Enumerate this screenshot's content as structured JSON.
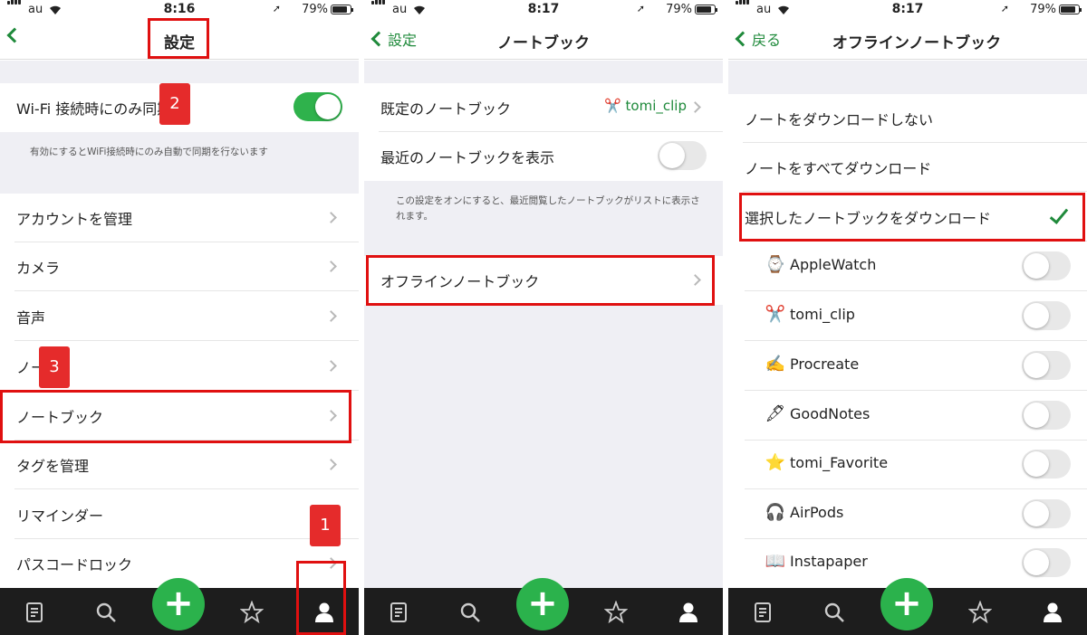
{
  "status": {
    "carrier": "au",
    "battery": "79%"
  },
  "panel1": {
    "time": "8:16",
    "title": "設定",
    "wifi_row": "Wi-Fi 接続時にのみ同期",
    "wifi_note": "有効にするとWiFi接続時にのみ自動で同期を行ないます",
    "items": [
      {
        "label": "アカウントを管理"
      },
      {
        "label": "カメラ"
      },
      {
        "label": "音声"
      },
      {
        "label": "ノート"
      },
      {
        "label": "ノートブック"
      },
      {
        "label": "タグを管理"
      },
      {
        "label": "リマインダー"
      },
      {
        "label": "パスコードロック"
      }
    ],
    "badges": [
      "1",
      "2",
      "3"
    ]
  },
  "panel2": {
    "time": "8:17",
    "back": "設定",
    "title": "ノートブック",
    "default_label": "既定のノートブック",
    "default_value": "tomi_clip",
    "recent_label": "最近のノートブックを表示",
    "recent_note": "この設定をオンにすると、最近閲覧したノートブックがリストに表示されます。",
    "offline_label": "オフラインノートブック"
  },
  "panel3": {
    "time": "8:17",
    "back": "戻る",
    "title": "オフラインノートブック",
    "options": [
      {
        "label": "ノートをダウンロードしない"
      },
      {
        "label": "ノートをすべてダウンロード"
      },
      {
        "label": "選択したノートブックをダウンロード",
        "selected": true
      }
    ],
    "notebooks": [
      {
        "emoji": "⌚",
        "name": "AppleWatch"
      },
      {
        "emoji": "✂️",
        "name": "tomi_clip"
      },
      {
        "emoji": "✍️",
        "name": "Procreate"
      },
      {
        "emoji": "🖋",
        "name": "GoodNotes"
      },
      {
        "emoji": "⭐",
        "name": "tomi_Favorite"
      },
      {
        "emoji": "🎧",
        "name": "AirPods"
      },
      {
        "emoji": "📖",
        "name": "Instapaper"
      }
    ]
  },
  "colors": {
    "accent": "#2bb24c",
    "highlight": "#e01010",
    "tabbar": "#1d1d1d"
  }
}
